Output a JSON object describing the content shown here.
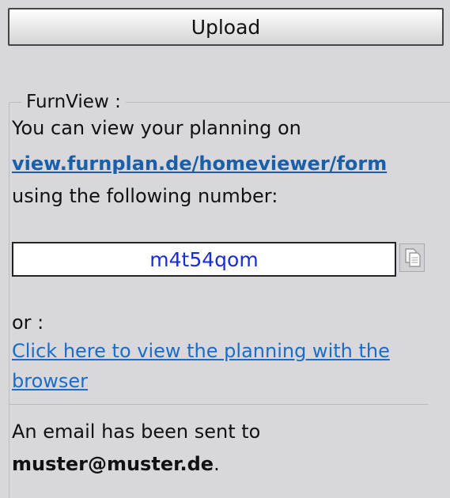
{
  "upload": {
    "label": "Upload"
  },
  "furnview": {
    "legend": "FurnView :",
    "intro": "You can view your planning on",
    "viewer_link": "view.furnplan.de/homeviewer/form",
    "number_intro": "using the following number:",
    "number": "m4t54qom",
    "copy_icon": "copy-icon",
    "or_label": "or :",
    "browser_link_line1": "Click here to view the planning with the",
    "browser_link_line2": "browser",
    "email_intro": "An email has been sent to",
    "email_address": "muster@muster.de",
    "email_period": "."
  },
  "colors": {
    "background": "#d8d8dc",
    "link_bold": "#1a5fa8",
    "link": "#1a6cc8",
    "code_text": "#1a2bd8"
  }
}
